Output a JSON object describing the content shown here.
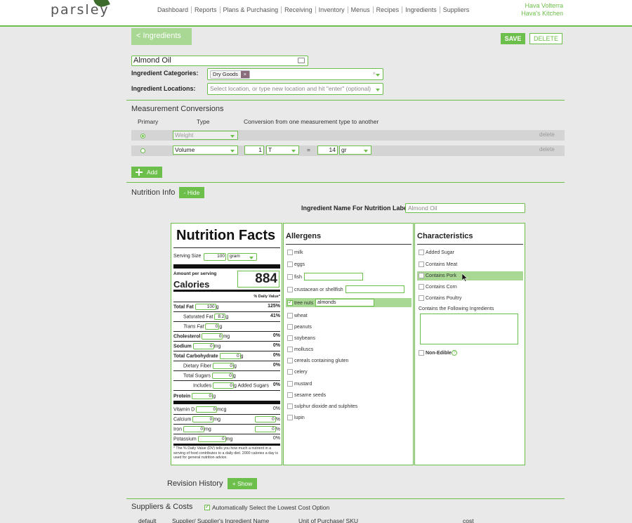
{
  "app": {
    "logo": "parsley",
    "nav": [
      "Dashboard",
      "Reports",
      "Plans & Purchasing",
      "Receiving",
      "Inventory",
      "Menus",
      "Recipes",
      "Ingredients",
      "Suppliers"
    ],
    "user_name": "Hava Volterra",
    "kitchen": "Hava's Kitchen"
  },
  "toolbar": {
    "back_label": "< Ingredients",
    "save_label": "SAVE",
    "delete_label": "DELETE"
  },
  "ingredient": {
    "name": "Almond Oil",
    "categories_label": "Ingredient Categories:",
    "category_chip": "Dry Goods",
    "locations_label": "Ingredient Locations:",
    "locations_placeholder": "Select location, or type new location and hit \"enter\" (optional)"
  },
  "conversions": {
    "title": "Measurement Conversions",
    "col_primary": "Primary",
    "col_type": "Type",
    "col_conversion": "Conversion from one measurement type to another",
    "rows": [
      {
        "type": "Weight",
        "delete": "delete"
      },
      {
        "type": "Volume",
        "qty1": "1",
        "unit1": "T",
        "eq": "=",
        "qty2": "14",
        "unit2": "gr",
        "delete": "delete"
      }
    ],
    "add_label": "Add"
  },
  "nutrition": {
    "title": "Nutrition Info",
    "hide_label": "- Hide",
    "label_name_label": "Ingredient Name For Nutrition Label:",
    "label_name_value": "Almond Oil",
    "facts": {
      "title": "Nutrition Facts",
      "serving_label": "Serving Size",
      "serving_qty": "100",
      "serving_unit": "gram",
      "amount_per": "Amount per serving",
      "calories_label": "Calories",
      "calories": "884",
      "dv_header": "% Daily Value*",
      "total_fat": "Total Fat",
      "total_fat_v": "100",
      "total_fat_u": "g",
      "total_fat_dv": "125%",
      "sat_fat": "Saturated Fat",
      "sat_fat_v": "8.2",
      "sat_fat_u": "g",
      "sat_fat_dv": "41%",
      "trans_fat": "Trans Fat",
      "trans_fat_v": "0",
      "trans_fat_u": "g",
      "chol": "Cholesterol",
      "chol_v": "0",
      "chol_u": "mg",
      "chol_dv": "0%",
      "sodium": "Sodium",
      "sodium_v": "0",
      "sodium_u": "mg",
      "sodium_dv": "0%",
      "carb": "Total Carbohydrate",
      "carb_v": "0",
      "carb_u": "g",
      "carb_dv": "0%",
      "fiber": "Dietary Fiber",
      "fiber_v": "0",
      "fiber_u": "g",
      "fiber_dv": "0%",
      "sugars": "Total Sugars",
      "sugars_v": "0",
      "sugars_u": "g",
      "includes": "Includes",
      "includes_v": "0",
      "includes_u": "g",
      "added_sugars": "Added Sugars",
      "added_dv": "0%",
      "protein": "Protein",
      "protein_v": "0",
      "protein_u": "g",
      "vitd": "Vitamin D",
      "vitd_v": "0",
      "vitd_u": "mcg",
      "vitd_dv": "0%",
      "calcium": "Calcium",
      "calcium_v": "0",
      "calcium_u": "mg",
      "calcium_dv_v": "0",
      "calcium_dv": "%",
      "iron": "Iron",
      "iron_v": "0",
      "iron_u": "mg",
      "iron_dv_v": "0",
      "iron_dv": "%",
      "potassium": "Potassium",
      "potassium_v": "0",
      "potassium_u": "mg",
      "potassium_dv": "0%",
      "footnote": "* The % Daily Value (DV) tells you how much a nutrient in a serving of food contributes to a daily diet. 2000 calories a day is used for general nutrition advice."
    },
    "allergens": {
      "title": "Allergens",
      "items": [
        "milk",
        "eggs",
        "fish",
        "crustacean or shellfish",
        "tree nuts",
        "wheat",
        "peanuts",
        "soybeans",
        "molluscs",
        "cereals containing gluten",
        "celery",
        "mustard",
        "sesame seeds",
        "sulphur dioxide and sulphites",
        "lupin"
      ],
      "tree_nuts_value": "almonds"
    },
    "characteristics": {
      "title": "Characteristics",
      "items": [
        "Added Sugar",
        "Contains Meat",
        "Contains Pork",
        "Contains Corn",
        "Contains Poultry"
      ],
      "contains_label": "Contains the Following Ingredients",
      "non_edible": "Non-Edible"
    }
  },
  "revision": {
    "title": "Revision History",
    "show_label": "+ Show"
  },
  "suppliers": {
    "title": "Suppliers & Costs",
    "auto_label": "Automatically Select the Lowest Cost Option",
    "cols": [
      "default",
      "Supplier/ Supplier's Ingredient Name",
      "Unit of Purchase/ SKU",
      "cost"
    ]
  },
  "colors": {
    "accent": "#6cbf4a",
    "highlight": "#a8d894"
  }
}
